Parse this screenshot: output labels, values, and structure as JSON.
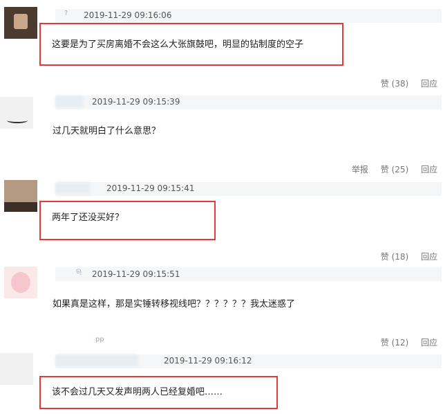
{
  "comments": [
    {
      "timestamp": "2019-11-29 09:16:06",
      "text": "这要是为了买房离婚不会这么大张旗鼓吧，明显的钻制度的空子"
    },
    {
      "timestamp": "2019-11-29 09:15:39",
      "text": "过几天就明白了什么意思？"
    },
    {
      "timestamp": "2019-11-29 09:15:41",
      "text": "两年了还没买好？"
    },
    {
      "timestamp": "2019-11-29 09:15:51",
      "text": "如果真是这样，那是实锤转移视线吧？？？？？？我太迷惑了"
    },
    {
      "timestamp": "2019-11-29 09:16:12",
      "text": "该不会过几天又发声明两人已经复婚吧……"
    }
  ],
  "actions": [
    {
      "like": "赞 (38)",
      "reply": "回应"
    },
    {
      "report": "举报",
      "like": "赞 (25)",
      "reply": "回应"
    },
    {
      "like": "赞 (18)",
      "reply": "回应"
    },
    {
      "like": "赞 (12)",
      "reply": "回应"
    }
  ],
  "stray_marks": [
    "?",
    "?",
    "ଋ",
    "pp"
  ]
}
